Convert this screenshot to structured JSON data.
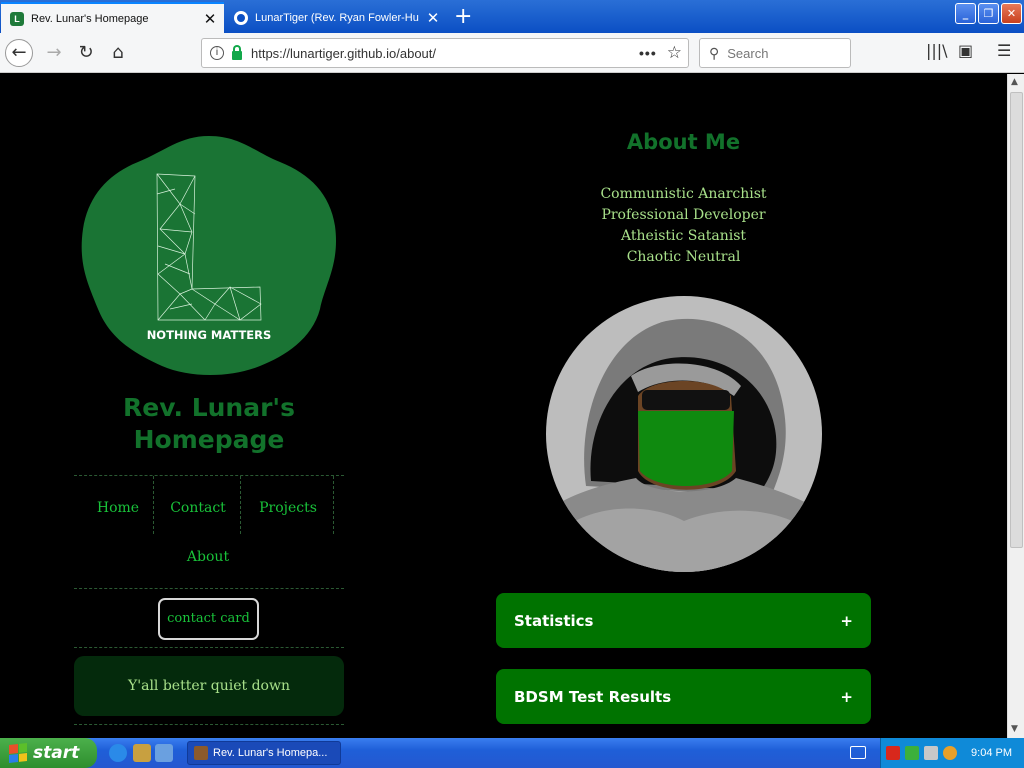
{
  "browser": {
    "tabs": [
      {
        "title": "Rev. Lunar's Homepage",
        "favicon": "L",
        "active": true
      },
      {
        "title": "LunarTiger (Rev. Ryan Fowler-Hu",
        "active": false
      }
    ],
    "new_tab_icon": "+",
    "url": "https://lunartiger.github.io/about/",
    "search_placeholder": "Search",
    "page_actions_icon": "•••",
    "bookmark_icon": "☆"
  },
  "sidebar": {
    "logo_text": "NOTHING MATTERS",
    "site_title": "Rev. Lunar's Homepage",
    "nav": [
      {
        "label": "Home"
      },
      {
        "label": "Contact"
      },
      {
        "label": "Projects"
      },
      {
        "label": "About"
      }
    ],
    "contact_card_label": "contact card",
    "quote": "Y'all better quiet down"
  },
  "about": {
    "title": "About Me",
    "traits": [
      "Communistic Anarchist",
      "Professional Developer",
      "Atheistic Satanist",
      "Chaotic Neutral"
    ],
    "accordions": [
      {
        "label": "Statistics",
        "icon": "+"
      },
      {
        "label": "BDSM Test Results",
        "icon": "+"
      }
    ]
  },
  "taskbar": {
    "start_label": "start",
    "task_label": "Rev. Lunar's Homepa...",
    "clock": "9:04 PM"
  },
  "colors": {
    "accent_green": "#12722b",
    "link_green": "#19c23a",
    "accordion_green": "#007300",
    "trait_text": "#a8e08a"
  }
}
